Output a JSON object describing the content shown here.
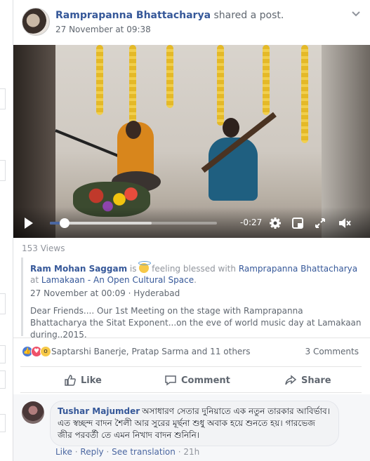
{
  "post": {
    "author": "Ramprapanna Bhattacharya",
    "action": "shared a post.",
    "timestamp": "27 November at 09:38",
    "menu_icon": "chevron-down-icon"
  },
  "video": {
    "time_remaining": "-0:27",
    "progress_fraction": 0.09,
    "buffered_fraction": 0.61,
    "icons": [
      "play-icon",
      "settings-icon",
      "picture-in-picture-icon",
      "fullscreen-icon",
      "volume-muted-icon"
    ]
  },
  "views": "153 Views",
  "shared_post": {
    "author": "Ram Mohan Saggam",
    "is_text": "is",
    "feeling": "feeling blessed with",
    "tagged": "Ramprapanna Bhattacharya",
    "at_text": "at",
    "place": "Lamakaan - An Open Cultural Space",
    "place_suffix": ".",
    "timestamp": "27 November at 00:09",
    "separator": "·",
    "location": "Hyderabad",
    "body": "Dear Friends.... Our 1st Meeting on the stage with Ramprapanna Bhattacharya the Sitat Exponent...on the eve of world music day at Lamakaan during..2015."
  },
  "reactions": {
    "names": "Saptarshi Banerje, Pratap Sarma and 11 others",
    "comments_count": "3 Comments",
    "types": [
      "like",
      "love",
      "wow"
    ]
  },
  "actions": {
    "like": "Like",
    "comment": "Comment",
    "share": "Share"
  },
  "comment": {
    "author": "Tushar Majumder",
    "text": "অসাধারণ সেতার দুনিয়াতে এক নতুন তারকার আবির্ভাব। এত স্বচ্ছন্দ বাদন শৈলী আর সুরের মূর্ছনা শুধু অবাক হয়ে শুনতে হয়। গারভেজ জীর পরবর্তী তে এমন নিখাদ বাদন শুনিনি।",
    "like": "Like",
    "reply": "Reply",
    "see_translation": "See translation",
    "age": "21h",
    "dot": "·"
  },
  "colors": {
    "link": "#365899",
    "progress": "#4b67a1",
    "background": "#e9ebee"
  }
}
